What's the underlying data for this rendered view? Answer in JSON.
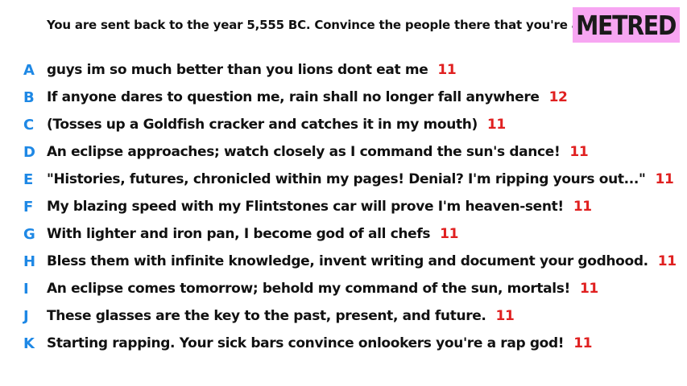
{
  "prompt": "You are sent back to the year 5,555 BC. Convince the people there that you're a god.",
  "logo": "METRED",
  "colors": {
    "letter": "#1e88e5",
    "score": "#e02020",
    "logo_bg": "#f7a6f2"
  },
  "answers": [
    {
      "letter": "A",
      "text": "guys im so much better than you lions dont eat me",
      "score": "11"
    },
    {
      "letter": "B",
      "text": "If anyone dares to question me, rain shall no longer fall anywhere",
      "score": "12"
    },
    {
      "letter": "C",
      "text": "(Tosses up a Goldfish cracker and catches it in my mouth)",
      "score": "11"
    },
    {
      "letter": "D",
      "text": "An eclipse approaches; watch closely as I command the sun's dance!",
      "score": "11"
    },
    {
      "letter": "E",
      "text": "\"Histories, futures, chronicled within my pages! Denial? I'm ripping yours out...\"",
      "score": "11"
    },
    {
      "letter": "F",
      "text": "My blazing speed with my Flintstones car will prove I'm heaven-sent!",
      "score": "11"
    },
    {
      "letter": "G",
      "text": "With lighter and iron pan, I become god of all chefs",
      "score": "11"
    },
    {
      "letter": "H",
      "text": "Bless them with infinite knowledge, invent writing and document your godhood.",
      "score": "11"
    },
    {
      "letter": "I",
      "text": "An eclipse comes tomorrow; behold my command of the sun, mortals!",
      "score": "11"
    },
    {
      "letter": "J",
      "text": "These glasses are the key to the past, present, and future.",
      "score": "11"
    },
    {
      "letter": "K",
      "text": "Starting rapping. Your sick bars convince onlookers you're a rap god!",
      "score": "11"
    }
  ]
}
